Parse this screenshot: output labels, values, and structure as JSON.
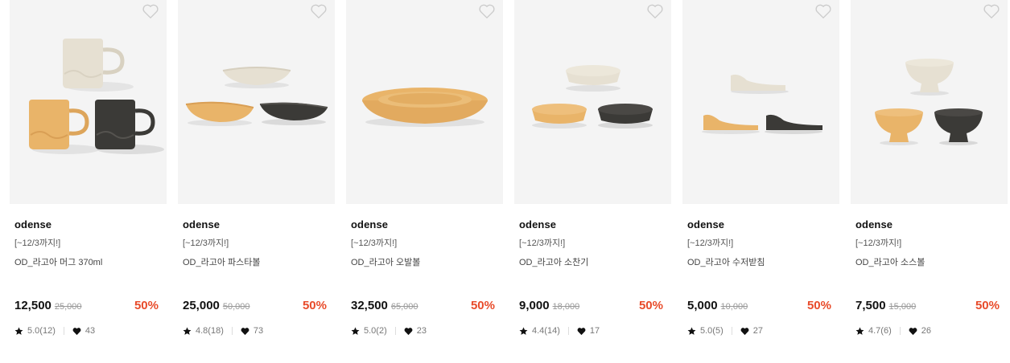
{
  "products": [
    {
      "brand": "odense",
      "promo": "[~12/3까지!]",
      "name": "OD_라고아 머그 370ml",
      "price": "12,500",
      "original_price": "25,000",
      "discount": "50%",
      "rating": "5.0(12)",
      "likes": "43"
    },
    {
      "brand": "odense",
      "promo": "[~12/3까지!]",
      "name": "OD_라고아 파스타볼",
      "price": "25,000",
      "original_price": "50,000",
      "discount": "50%",
      "rating": "4.8(18)",
      "likes": "73"
    },
    {
      "brand": "odense",
      "promo": "[~12/3까지!]",
      "name": "OD_라고아 오발볼",
      "price": "32,500",
      "original_price": "65,000",
      "discount": "50%",
      "rating": "5.0(2)",
      "likes": "23"
    },
    {
      "brand": "odense",
      "promo": "[~12/3까지!]",
      "name": "OD_라고아 소찬기",
      "price": "9,000",
      "original_price": "18,000",
      "discount": "50%",
      "rating": "4.4(14)",
      "likes": "17"
    },
    {
      "brand": "odense",
      "promo": "[~12/3까지!]",
      "name": "OD_라고아 수저받침",
      "price": "5,000",
      "original_price": "10,000",
      "discount": "50%",
      "rating": "5.0(5)",
      "likes": "27"
    },
    {
      "brand": "odense",
      "promo": "[~12/3까지!]",
      "name": "OD_라고아 소스볼",
      "price": "7,500",
      "original_price": "15,000",
      "discount": "50%",
      "rating": "4.7(6)",
      "likes": "26"
    }
  ],
  "icons": {
    "wishlist": "heart-outline-icon",
    "rating": "star-icon",
    "likes": "heart-filled-icon"
  },
  "colors": {
    "discount": "#e84b2a",
    "thumbnail_bg": "#f4f4f4",
    "cream": "#e6e0d2",
    "mustard": "#e9b469",
    "charcoal": "#3b3a37"
  }
}
